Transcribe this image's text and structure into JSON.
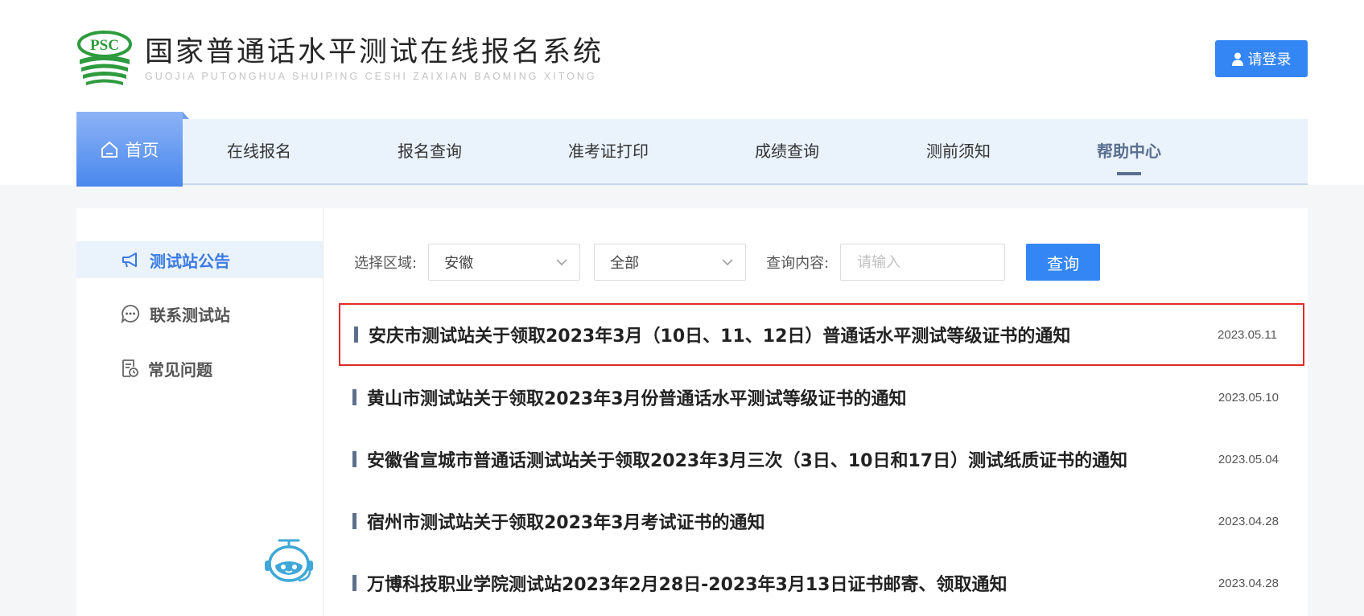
{
  "header": {
    "logo_badge": "PSC",
    "title_cn": "国家普通话水平测试在线报名系统",
    "title_pinyin": "GUOJIA PUTONGHUA SHUIPING CESHI ZAIXIAN BAOMING XITONG",
    "login_label": "请登录"
  },
  "nav": {
    "home": "首页",
    "items": [
      "在线报名",
      "报名查询",
      "准考证打印",
      "成绩查询",
      "测前须知",
      "帮助中心"
    ],
    "active": "帮助中心"
  },
  "sidebar": {
    "items": [
      {
        "label": "测试站公告",
        "icon": "megaphone-icon",
        "active": true
      },
      {
        "label": "联系测试站",
        "icon": "chat-bubble-icon",
        "active": false
      },
      {
        "label": "常见问题",
        "icon": "faq-document-icon",
        "active": false
      }
    ]
  },
  "filters": {
    "region_label": "选择区域:",
    "region_value": "安徽",
    "scope_value": "全部",
    "query_label": "查询内容:",
    "query_placeholder": "请输入",
    "search_label": "查询"
  },
  "notices": [
    {
      "title": "安庆市测试站关于领取2023年3月（10日、11、12日）普通话水平测试等级证书的通知",
      "date": "2023.05.11",
      "highlighted": true
    },
    {
      "title": "黄山市测试站关于领取2023年3月份普通话水平测试等级证书的通知",
      "date": "2023.05.10",
      "highlighted": false
    },
    {
      "title": "安徽省宣城市普通话测试站关于领取2023年3月三次（3日、10日和17日）测试纸质证书的通知",
      "date": "2023.05.04",
      "highlighted": false
    },
    {
      "title": "宿州市测试站关于领取2023年3月考试证书的通知",
      "date": "2023.04.28",
      "highlighted": false
    },
    {
      "title": "万博科技职业学院测试站2023年2月28日-2023年3月13日证书邮寄、领取通知",
      "date": "2023.04.28",
      "highlighted": false
    }
  ],
  "colors": {
    "accent": "#3486f4",
    "nav_bg": "#eaf2fc",
    "highlight_border": "#e02a2a",
    "logo_green": "#2e9b3e"
  }
}
